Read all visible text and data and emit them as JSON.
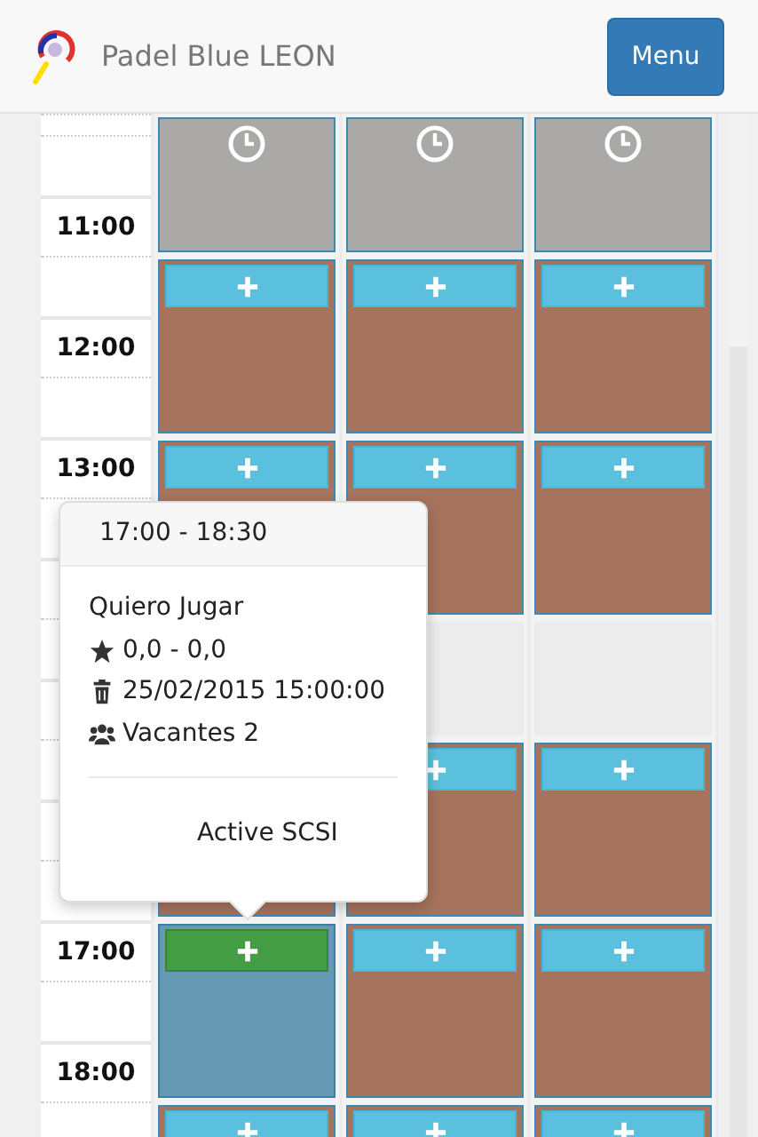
{
  "header": {
    "title": "Padel Blue LEON",
    "menu_button": "Menu"
  },
  "time_rows": [
    {
      "kind": "half"
    },
    {
      "kind": "half"
    },
    {
      "kind": "hour",
      "label": "11:00"
    },
    {
      "kind": "half"
    },
    {
      "kind": "hour",
      "label": "12:00"
    },
    {
      "kind": "half"
    },
    {
      "kind": "hour",
      "label": "13:00"
    },
    {
      "kind": "half"
    },
    {
      "kind": "hour"
    },
    {
      "kind": "half"
    },
    {
      "kind": "hour"
    },
    {
      "kind": "half"
    },
    {
      "kind": "hour"
    },
    {
      "kind": "half"
    },
    {
      "kind": "hour",
      "label": "17:00"
    },
    {
      "kind": "half"
    },
    {
      "kind": "hour",
      "label": "18:00"
    },
    {
      "kind": "half"
    }
  ],
  "courts": [
    {
      "slots": [
        {
          "kind": "past"
        },
        {
          "kind": "open"
        },
        {
          "kind": "open"
        },
        {
          "kind": "hidden"
        },
        {
          "kind": "covered"
        },
        {
          "kind": "selected"
        },
        {
          "kind": "open"
        }
      ]
    },
    {
      "slots": [
        {
          "kind": "past"
        },
        {
          "kind": "open"
        },
        {
          "kind": "open"
        },
        {
          "kind": "empty"
        },
        {
          "kind": "open"
        },
        {
          "kind": "open"
        },
        {
          "kind": "open"
        }
      ]
    },
    {
      "slots": [
        {
          "kind": "past"
        },
        {
          "kind": "open"
        },
        {
          "kind": "open"
        },
        {
          "kind": "empty"
        },
        {
          "kind": "open"
        },
        {
          "kind": "open"
        },
        {
          "kind": "open"
        }
      ]
    }
  ],
  "popover": {
    "title": "17:00 - 18:30",
    "name": "Quiero Jugar",
    "lines": [
      {
        "kind": "level",
        "text": "0,0 - 0,0"
      },
      {
        "kind": "date",
        "text": "25/02/2015 15:00:00"
      },
      {
        "kind": "vacancies",
        "text": "Vacantes 2"
      }
    ],
    "footer": "Active SCSI"
  }
}
